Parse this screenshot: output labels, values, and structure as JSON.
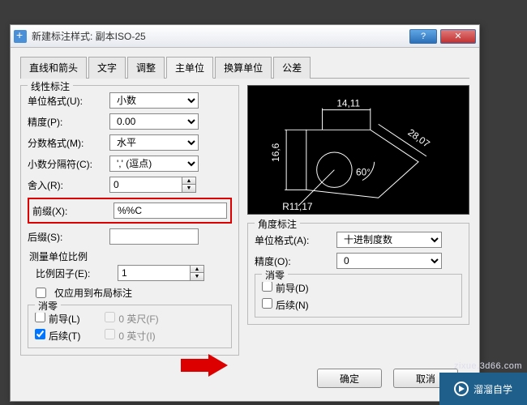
{
  "window": {
    "title": "新建标注样式: 副本ISO-25"
  },
  "tabs": [
    "直线和箭头",
    "文字",
    "调整",
    "主单位",
    "换算单位",
    "公差"
  ],
  "active_tab": 3,
  "linear": {
    "group_title": "线性标注",
    "unit_format_label": "单位格式(U):",
    "unit_format_value": "小数",
    "precision_label": "精度(P):",
    "precision_value": "0.00",
    "fraction_label": "分数格式(M):",
    "fraction_value": "水平",
    "decimal_sep_label": "小数分隔符(C):",
    "decimal_sep_value": "','  (逗点)",
    "round_label": "舍入(R):",
    "round_value": "0",
    "prefix_label": "前缀(X):",
    "prefix_value": "%%C",
    "suffix_label": "后缀(S):",
    "suffix_value": ""
  },
  "scale": {
    "title": "测量单位比例",
    "factor_label": "比例因子(E):",
    "factor_value": "1",
    "layout_only_label": "仅应用到布局标注"
  },
  "zero_l": {
    "title": "消零",
    "leading_label": "前导(L)",
    "trailing_label": "后续(T)",
    "feet_label": "0 英尺(F)",
    "inch_label": "0 英寸(I)"
  },
  "preview": {
    "top_dim": "14,11",
    "left_dim": "16,6",
    "right_dim": "28,07",
    "radius": "R11,17",
    "angle": "60°"
  },
  "angular": {
    "group_title": "角度标注",
    "unit_format_label": "单位格式(A):",
    "unit_format_value": "十进制度数",
    "precision_label": "精度(O):",
    "precision_value": "0",
    "zero_title": "消零",
    "leading_label": "前导(D)",
    "trailing_label": "后续(N)"
  },
  "buttons": {
    "ok": "确定",
    "cancel": "取消"
  },
  "watermark": {
    "text": "溜溜自学",
    "url": "zixue.3d66.com"
  }
}
